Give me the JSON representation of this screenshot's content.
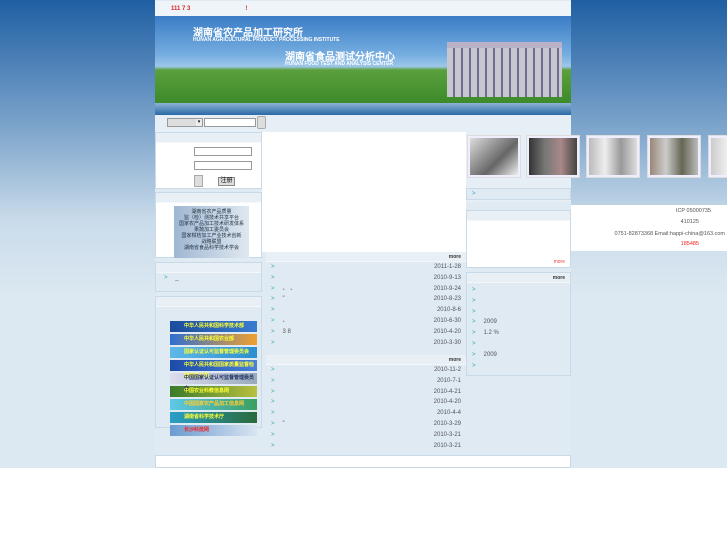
{
  "topbar": {
    "text": "111 7 3",
    "alert": "!"
  },
  "banner": {
    "title_cn": "湖南省农产品加工研究所",
    "title_en": "HUNAN AGRICULTURAL PRODUCT PROCESSING INSTITUTE",
    "subtitle_cn": "湖南省食品测试分析中心",
    "subtitle_en": "HUNAN FOOD TEST AND ANALYSIS CENTER"
  },
  "login": {
    "register_label": "注册"
  },
  "orgs": [
    "湖南省农产品质量",
    "监（检）测技术共享平台",
    "国家农产品加工技术研发体系",
    "果蔬加工委员会",
    "国家柑桔加工产业技术创新",
    "战略联盟",
    "湖南省食品科学技术学会"
  ],
  "left_list": {
    "item": "_"
  },
  "link_banners": [
    "中华人民共和国科学技术部",
    "中华人民共和国农业部",
    "国家认证认可监督管理委员会",
    "中华人民共和国国家质量监督检验检疫总局",
    "中国国家认证认可监督管理委员会",
    "中国农业科教信息网",
    "中国国家农产品加工信息网",
    "湖南省科学技术厅",
    "长沙科技网"
  ],
  "news1": {
    "more": "more",
    "items": [
      {
        "title": "",
        "date": "2011-1-28"
      },
      {
        "title": "",
        "date": "2010-9-13"
      },
      {
        "title": "、 、",
        "date": "2010-9-24"
      },
      {
        "title": "\"",
        "date": "2010-8-23"
      },
      {
        "title": "",
        "date": "2010-8-6"
      },
      {
        "title": "、",
        "date": "2010-6-30"
      },
      {
        "title": "3 8",
        "date": "2010-4-20"
      },
      {
        "title": "",
        "date": "2010-3-30"
      }
    ]
  },
  "news2": {
    "more": "more",
    "items": [
      {
        "title": "",
        "date": "2010-11-2"
      },
      {
        "title": "",
        "date": "2010-7-1"
      },
      {
        "title": "",
        "date": "2010-4-21"
      },
      {
        "title": "",
        "date": "2010-4-20"
      },
      {
        "title": "",
        "date": "2010-4-4"
      },
      {
        "title": "\"",
        "date": "2010-3-29"
      },
      {
        "title": "",
        "date": "2010-3-21"
      },
      {
        "title": "",
        "date": "2010-3-21"
      }
    ]
  },
  "right_box": {
    "more": "more"
  },
  "right_list": {
    "more": "more",
    "items": [
      "",
      "",
      "",
      "2009",
      "1.2 %",
      "",
      "2009",
      ""
    ]
  },
  "footer": {
    "icp": "ICP 05000735",
    "postcode": "410125",
    "contact": "0751-82873368 Email:happi-china@163.com",
    "counter": "185485"
  },
  "colors": {
    "accent_red": "#dd2222",
    "arrow": "#33aaaa"
  }
}
